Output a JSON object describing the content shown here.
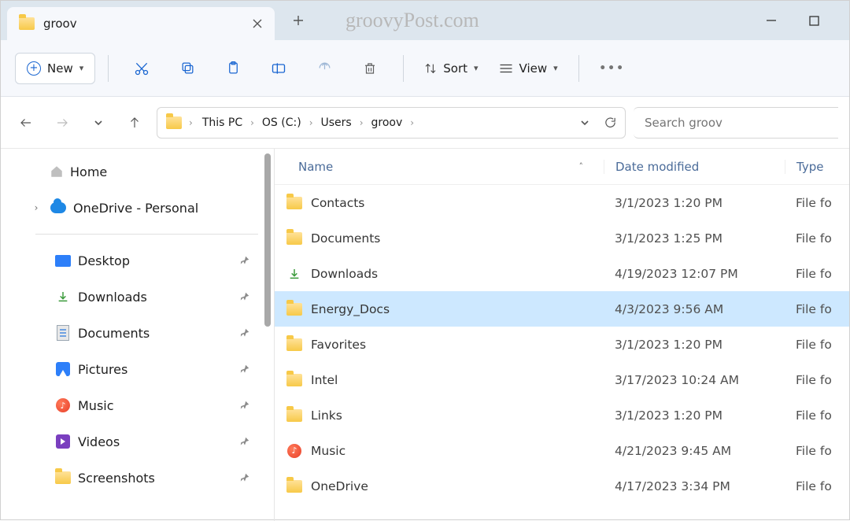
{
  "titlebar": {
    "tab_title": "groov",
    "watermark": "groovyPost.com"
  },
  "toolbar": {
    "new_label": "New",
    "sort_label": "Sort",
    "view_label": "View"
  },
  "nav": {
    "breadcrumb": [
      "This PC",
      "OS (C:)",
      "Users",
      "groov"
    ],
    "search_placeholder": "Search groov"
  },
  "sidebar": {
    "home_label": "Home",
    "onedrive_label": "OneDrive - Personal",
    "quick": [
      {
        "label": "Desktop",
        "icon": "desktop"
      },
      {
        "label": "Downloads",
        "icon": "downloads"
      },
      {
        "label": "Documents",
        "icon": "documents"
      },
      {
        "label": "Pictures",
        "icon": "pictures"
      },
      {
        "label": "Music",
        "icon": "music"
      },
      {
        "label": "Videos",
        "icon": "videos"
      },
      {
        "label": "Screenshots",
        "icon": "folder"
      }
    ]
  },
  "columns": {
    "name": "Name",
    "date": "Date modified",
    "type": "Type"
  },
  "rows": [
    {
      "name": "Contacts",
      "date": "3/1/2023 1:20 PM",
      "type": "File fo",
      "icon": "folder",
      "selected": false
    },
    {
      "name": "Documents",
      "date": "3/1/2023 1:25 PM",
      "type": "File fo",
      "icon": "folder",
      "selected": false
    },
    {
      "name": "Downloads",
      "date": "4/19/2023 12:07 PM",
      "type": "File fo",
      "icon": "downloads",
      "selected": false
    },
    {
      "name": "Energy_Docs",
      "date": "4/3/2023 9:56 AM",
      "type": "File fo",
      "icon": "folder",
      "selected": true
    },
    {
      "name": "Favorites",
      "date": "3/1/2023 1:20 PM",
      "type": "File fo",
      "icon": "folder",
      "selected": false
    },
    {
      "name": "Intel",
      "date": "3/17/2023 10:24 AM",
      "type": "File fo",
      "icon": "folder",
      "selected": false
    },
    {
      "name": "Links",
      "date": "3/1/2023 1:20 PM",
      "type": "File fo",
      "icon": "folder",
      "selected": false
    },
    {
      "name": "Music",
      "date": "4/21/2023 9:45 AM",
      "type": "File fo",
      "icon": "music",
      "selected": false
    },
    {
      "name": "OneDrive",
      "date": "4/17/2023 3:34 PM",
      "type": "File fo",
      "icon": "folder",
      "selected": false
    }
  ]
}
